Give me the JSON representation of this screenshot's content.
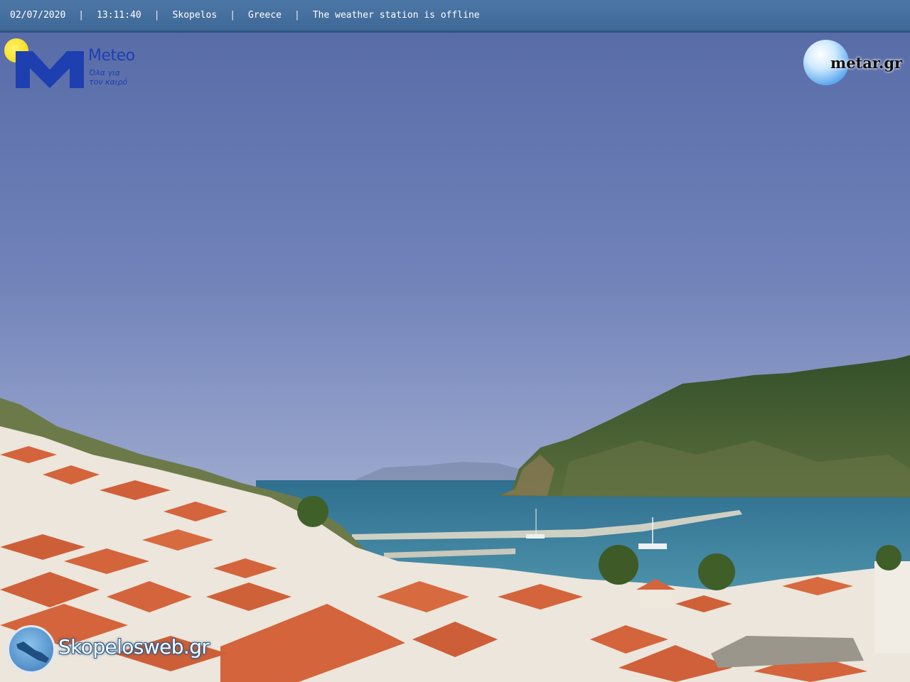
{
  "info_bar": {
    "date": "02/07/2020",
    "time": "13:11:40",
    "location": "Skopelos",
    "country": "Greece",
    "status": "The weather station is offline",
    "separator": "|"
  },
  "logos": {
    "meteo": {
      "name": "Meteo",
      "tagline_line1": "Όλα για",
      "tagline_line2": "τον καιρό",
      "color": "#1e3fb0"
    },
    "metar": {
      "name": "metar.gr",
      "icon": "golf-ball-icon"
    },
    "skopelosweb": {
      "name": "Skopelosweb.gr",
      "icon": "island-map-icon"
    }
  },
  "scene": {
    "description_icon": "harbor-landscape",
    "colors": {
      "sky_top": "#5b70a8",
      "sky_horizon": "#8f9fc8",
      "sea": "#3d7f9c",
      "mountain": "#3f5a2e",
      "roof": "#d6623b",
      "wall": "#ece6dc"
    }
  }
}
